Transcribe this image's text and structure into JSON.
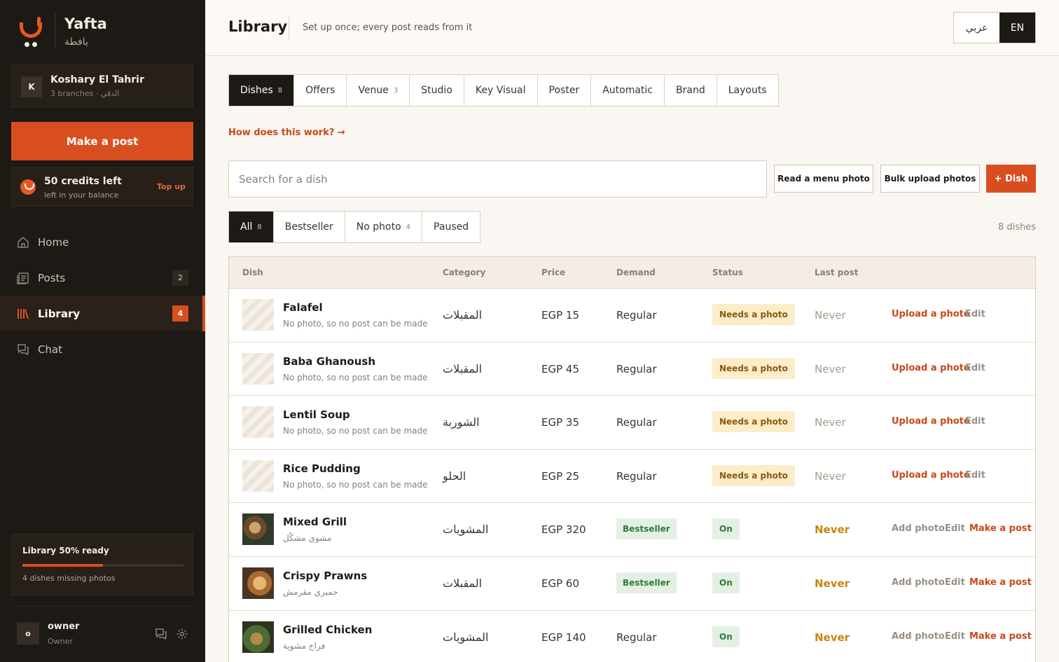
{
  "brand": {
    "name_en": "Yafta",
    "name_ar": "يافطة",
    "accent": "#d94e1f"
  },
  "account": {
    "initial": "K",
    "name": "Koshary El Tahrir",
    "sub": "3 branches · الدقي"
  },
  "sidebar": {
    "make_post": "Make a post",
    "credits": {
      "title": "50 credits left",
      "sub": "left in your balance",
      "topup": "Top up"
    },
    "nav": [
      {
        "label": "Home",
        "icon": "home-icon",
        "badge": ""
      },
      {
        "label": "Posts",
        "icon": "posts-icon",
        "badge": "2"
      },
      {
        "label": "Library",
        "icon": "library-icon",
        "badge": "4",
        "active": true
      },
      {
        "label": "Chat",
        "icon": "chat-icon",
        "badge": ""
      }
    ],
    "library_ready": {
      "title": "Library 50% ready",
      "progress": 0.5,
      "sub": "4 dishes missing photos"
    },
    "user": {
      "initial": "o",
      "name": "owner",
      "role": "Owner"
    }
  },
  "header": {
    "title": "Library",
    "subtitle": "Set up once; every post reads from it",
    "lang_ar": "عربي",
    "lang_en": "EN"
  },
  "tabs": [
    {
      "label": "Dishes",
      "count": "8",
      "active": true
    },
    {
      "label": "Offers",
      "count": ""
    },
    {
      "label": "Venue",
      "count": "3"
    },
    {
      "label": "Studio",
      "count": ""
    },
    {
      "label": "Key Visual",
      "count": ""
    },
    {
      "label": "Poster",
      "count": ""
    },
    {
      "label": "Automatic",
      "count": ""
    },
    {
      "label": "Brand",
      "count": ""
    },
    {
      "label": "Layouts",
      "count": ""
    }
  ],
  "how_link": "How does this work? →",
  "search": {
    "placeholder": "Search for a dish",
    "value": ""
  },
  "actions": {
    "read_menu": "Read a menu photo",
    "bulk_upload": "Bulk upload photos",
    "add_dish": "+ Dish"
  },
  "filters": [
    {
      "label": "All",
      "count": "8",
      "active": true
    },
    {
      "label": "Bestseller",
      "count": ""
    },
    {
      "label": "No photo",
      "count": "4"
    },
    {
      "label": "Paused",
      "count": ""
    }
  ],
  "dish_count": "8 dishes",
  "table": {
    "headers": {
      "dish": "Dish",
      "category": "Category",
      "price": "Price",
      "demand": "Demand",
      "status": "Status",
      "last_post": "Last post"
    },
    "rows": [
      {
        "name": "Falafel",
        "sub": "No photo, so no post can be made",
        "category": "المقبلات",
        "price": "EGP 15",
        "demand": "Regular",
        "status": "Needs a photo",
        "last": "Never",
        "a1": "Upload a photo",
        "a2": "Edit",
        "a3": ""
      },
      {
        "name": "Baba Ghanoush",
        "sub": "No photo, so no post can be made",
        "category": "المقبلات",
        "price": "EGP 45",
        "demand": "Regular",
        "status": "Needs a photo",
        "last": "Never",
        "a1": "Upload a photo",
        "a2": "Edit",
        "a3": ""
      },
      {
        "name": "Lentil Soup",
        "sub": "No photo, so no post can be made",
        "category": "الشوربة",
        "price": "EGP 35",
        "demand": "Regular",
        "status": "Needs a photo",
        "last": "Never",
        "a1": "Upload a photo",
        "a2": "Edit",
        "a3": ""
      },
      {
        "name": "Rice Pudding",
        "sub": "No photo, so no post can be made",
        "category": "الحلو",
        "price": "EGP 25",
        "demand": "Regular",
        "status": "Needs a photo",
        "last": "Never",
        "a1": "Upload a photo",
        "a2": "Edit",
        "a3": ""
      },
      {
        "name": "Mixed Grill",
        "sub": "مشوي مشكّل",
        "category": "المشويات",
        "price": "EGP 320",
        "demand": "Bestseller",
        "status": "On",
        "last": "Never",
        "a1": "Add photo",
        "a2": "Edit",
        "a3": "Make a post"
      },
      {
        "name": "Crispy Prawns",
        "sub": "جمبري مقرمش",
        "category": "المقبلات",
        "price": "EGP 60",
        "demand": "Bestseller",
        "status": "On",
        "last": "Never",
        "a1": "Add photo",
        "a2": "Edit",
        "a3": "Make a post"
      },
      {
        "name": "Grilled Chicken",
        "sub": "فراخ مشوية",
        "category": "المشويات",
        "price": "EGP 140",
        "demand": "Regular",
        "status": "On",
        "last": "Never",
        "a1": "Add photo",
        "a2": "Edit",
        "a3": "Make a post"
      }
    ]
  }
}
